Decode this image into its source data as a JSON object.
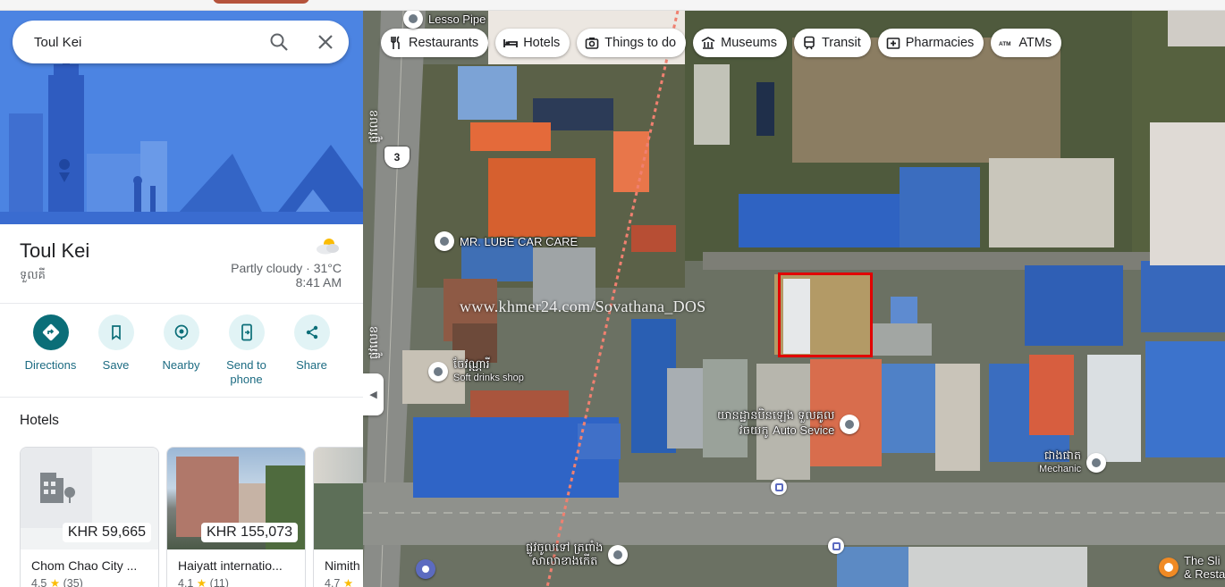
{
  "search": {
    "value": "Toul Kei"
  },
  "place": {
    "title": "Toul Kei",
    "subtitle": "ទួលគី",
    "weather": {
      "condition": "Partly cloudy · 31°C",
      "time": "8:41 AM"
    }
  },
  "actions": [
    {
      "label": "Directions"
    },
    {
      "label": "Save"
    },
    {
      "label": "Nearby"
    },
    {
      "label": "Send to phone"
    },
    {
      "label": "Share"
    }
  ],
  "hotels_section": {
    "title": "Hotels",
    "items": [
      {
        "name": "Chom Chao City ...",
        "price": "KHR 59,665",
        "rating": "4.5",
        "reviews": "(35)"
      },
      {
        "name": "Haiyatt internatio...",
        "price": "KHR 155,073",
        "rating": "4.1",
        "reviews": "(11)"
      },
      {
        "name": "Nimith",
        "price": "",
        "rating": "4.7",
        "reviews": ""
      }
    ]
  },
  "map": {
    "chips": [
      {
        "label": "Restaurants",
        "icon": "fork-knife-icon"
      },
      {
        "label": "Hotels",
        "icon": "bed-icon"
      },
      {
        "label": "Things to do",
        "icon": "camera-icon"
      },
      {
        "label": "Museums",
        "icon": "museum-icon"
      },
      {
        "label": "Transit",
        "icon": "train-icon"
      },
      {
        "label": "Pharmacies",
        "icon": "pharmacy-icon"
      },
      {
        "label": "ATMs",
        "icon": "atm-icon"
      }
    ],
    "pois": {
      "lesso": "Lesso Pipe",
      "lube": "MR. LUBE CAR CARE",
      "soft_km": "ចែវណ្ណារី",
      "soft": "Soft drinks shop",
      "auto_km1": "យានដ្ឋានបិនឡេង ទួលគូល",
      "auto_km2": "វចយកូ",
      "auto": "Auto Sevice",
      "mech_km": "ជាងផាត",
      "mech": "Mechanic",
      "school_km1": "ផ្លូវចូលទៅ ត្រពាំង",
      "school_km2": "សាលាខាងកើត",
      "slice1": "The Sli",
      "slice2": "& Resta"
    },
    "road_shield": "3",
    "road_name_1": "ផ្លូវលេខ",
    "road_name_2": "ផ្លូវលេខ",
    "watermark": "www.khmer24.com/Sovathana_DOS"
  },
  "colors": {
    "accent": "#1a73e8",
    "primary_action": "#0b6e78",
    "highlight_box": "#e10000"
  }
}
